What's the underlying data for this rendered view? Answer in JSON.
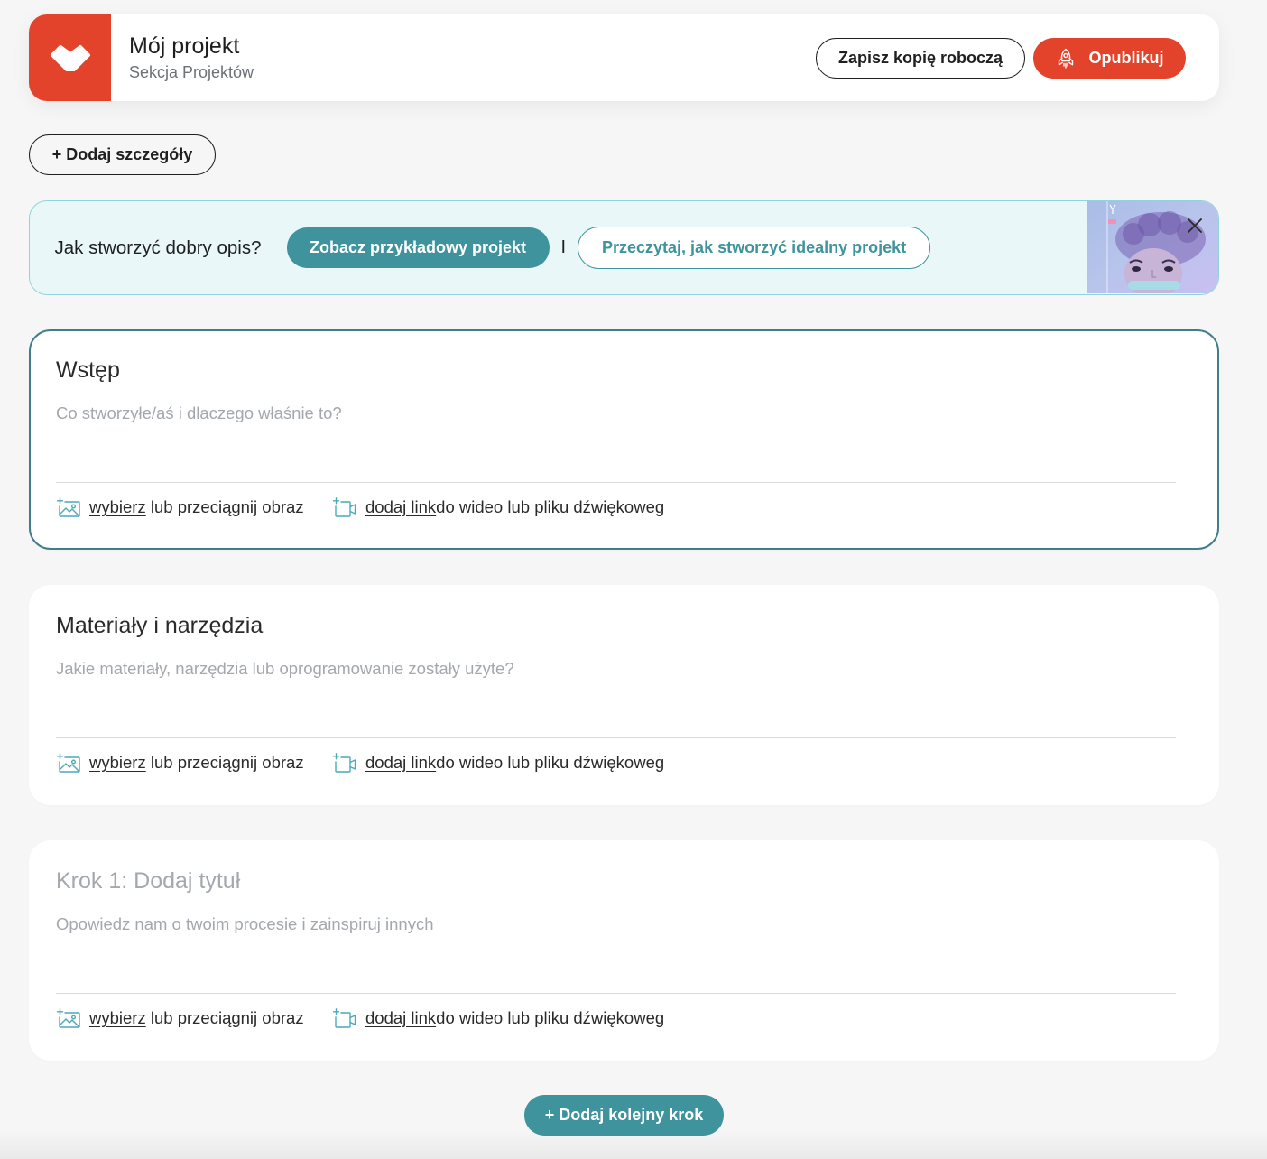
{
  "header": {
    "logo_icon": "brand-logo-icon",
    "title": "Mój projekt",
    "subtitle": "Sekcja Projektów",
    "save_draft_label": "Zapisz kopię roboczą",
    "publish_label": "Opublikuj",
    "publish_icon": "rocket-icon"
  },
  "add_details_label": "+ Dodaj szczegóły",
  "tip_banner": {
    "question": "Jak stworzyć dobry opis?",
    "example_button_label": "Zobacz przykładowy projekt",
    "separator": "I",
    "guide_button_label": "Przeczytaj, jak stworzyć idealny projekt",
    "close_icon": "close-icon"
  },
  "sections": [
    {
      "title": "Wstęp",
      "description_placeholder": "Co stworzyłe/aś i dlaczego właśnie to?",
      "focused": true,
      "image_upload": {
        "icon": "add-image-icon",
        "link_label": "wybierz",
        "text": "lub przeciągnij obraz"
      },
      "media_link": {
        "icon": "add-video-icon",
        "link_label": "dodaj link",
        "text": "do wideo lub pliku dźwiękoweg"
      }
    },
    {
      "title": "Materiały i narzędzia",
      "description_placeholder": "Jakie materiały, narzędzia lub oprogramowanie zostały użyte?",
      "focused": false,
      "image_upload": {
        "icon": "add-image-icon",
        "link_label": "wybierz",
        "text": "lub przeciągnij obraz"
      },
      "media_link": {
        "icon": "add-video-icon",
        "link_label": "dodaj link",
        "text": "do wideo lub pliku dźwiękoweg"
      }
    },
    {
      "title_placeholder": "Krok 1: Dodaj tytuł",
      "description_placeholder": "Opowiedz nam o twoim procesie i zainspiruj innych",
      "focused": false,
      "image_upload": {
        "icon": "add-image-icon",
        "link_label": "wybierz",
        "text": "lub przeciągnij obraz"
      },
      "media_link": {
        "icon": "add-video-icon",
        "link_label": "dodaj link",
        "text": "do wideo lub pliku dźwiękoweg"
      }
    }
  ],
  "add_step_label": "+ Dodaj kolejny krok",
  "colors": {
    "page_background": "#f6f6f6",
    "brand_red": "#e3432b",
    "teal": "#3e939d",
    "teal_dark_border": "#417e8a",
    "banner_background": "#e9f7f9",
    "banner_border": "#8fd4dd",
    "text_dark": "#222222",
    "placeholder_gray": "#a3a8ae",
    "icon_teal": "#4aaab6"
  }
}
